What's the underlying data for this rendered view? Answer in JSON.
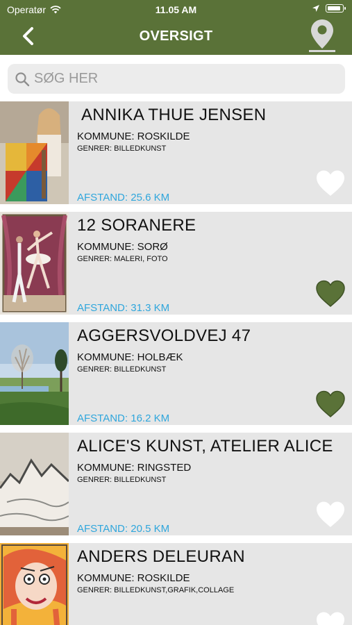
{
  "status_bar": {
    "carrier": "Operatør",
    "time": "11.05 AM"
  },
  "nav": {
    "title": "OVERSIGT",
    "back_icon": "chevron-left-icon",
    "map_icon": "map-pin-icon"
  },
  "search": {
    "placeholder": "SØG HER",
    "value": ""
  },
  "colors": {
    "brand_green": "#5a7238",
    "distance_blue": "#2fa6dc",
    "row_bg": "#e6e6e6"
  },
  "items": [
    {
      "name": "ANNIKA THUE JENSEN",
      "kommune": "KOMMUNE: ROSKILDE",
      "genrer": "GENRER: BILLEDKUNST",
      "afstand": "AFSTAND: 25.6 KM",
      "favorite": false
    },
    {
      "name": "12 SORANERE",
      "kommune": "KOMMUNE: SORØ",
      "genrer": "GENRER: MALERI, FOTO",
      "afstand": "AFSTAND: 31.3 KM",
      "favorite": true
    },
    {
      "name": "AGGERSVOLDVEJ 47",
      "kommune": "KOMMUNE: HOLBÆK",
      "genrer": "GENRER: BILLEDKUNST",
      "afstand": "AFSTAND: 16.2 KM",
      "favorite": true
    },
    {
      "name": "ALICE'S KUNST, ATELIER ALICE",
      "kommune": "KOMMUNE: RINGSTED",
      "genrer": "GENRER: BILLEDKUNST",
      "afstand": "AFSTAND: 20.5 KM",
      "favorite": false
    },
    {
      "name": "ANDERS DELEURAN",
      "kommune": "KOMMUNE: ROSKILDE",
      "genrer": "GENRER: BILLEDKUNST,GRAFIK,COLLAGE",
      "afstand": "",
      "favorite": false
    }
  ]
}
